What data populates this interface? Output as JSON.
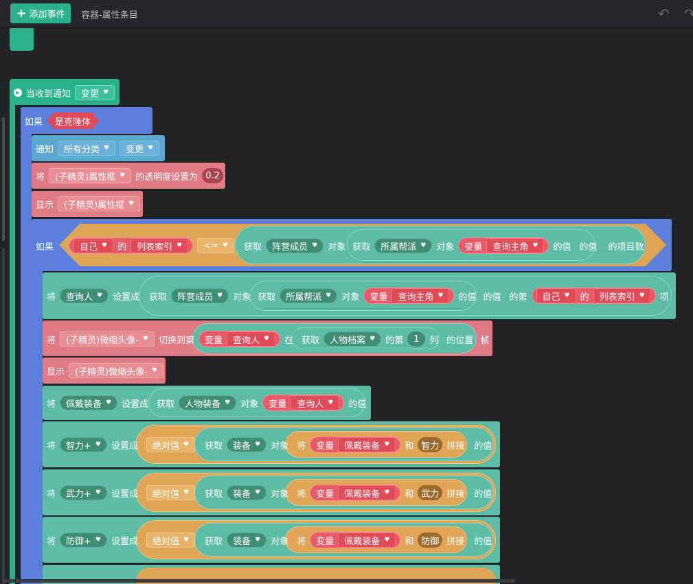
{
  "topbar": {
    "add_label": "添加事件",
    "title": "容器-属性条目",
    "undo_icon": "↶",
    "redo_icon": "↷"
  },
  "hat": {
    "label": "当收到通知",
    "dropdown": "变更"
  },
  "if1": {
    "label": "如果",
    "condition": "是克隆体"
  },
  "notify": {
    "label": "通知",
    "target": "所有分类",
    "event": "变更"
  },
  "set_opacity": {
    "prefix": "将",
    "target": "(子精灵)属性框",
    "text": "的透明度设置为",
    "value": "0.2"
  },
  "show1": {
    "label": "显示",
    "target": "(子精灵)属性框"
  },
  "if2": {
    "label": "如果",
    "self": "自己",
    "of": "的",
    "prop": "列表索引",
    "op": "<=",
    "get": "获取",
    "member": "阵营成员",
    "obj": "对象",
    "get2": "获取",
    "faction": "所属帮派",
    "obj2": "对象",
    "var": "变量",
    "varname": "查询主角",
    "val": "的值",
    "val2": "的值",
    "count": "的项目数"
  },
  "set_query": {
    "prefix": "将",
    "target": "查询人",
    "text": "设置成",
    "get": "获取",
    "member": "阵营成员",
    "obj": "对象",
    "get2": "获取",
    "faction": "所属帮派",
    "obj2": "对象",
    "var": "变量",
    "varname": "查询主角",
    "val": "的值",
    "val2": "的值",
    "nth": "的第",
    "self": "自己",
    "of": "的",
    "prop": "列表索引",
    "item": "项"
  },
  "switch_frame": {
    "prefix": "将",
    "target": "(子精灵)微缩头像-",
    "text": "切换到第",
    "var": "变量",
    "varname": "查询人",
    "in": "在",
    "get": "获取",
    "archive": "人物档案",
    "nth": "的第",
    "col": "1",
    "colword": "列",
    "pos": "的位置",
    "frame": "帧"
  },
  "show2": {
    "label": "显示",
    "target": "(子精灵)微缩头像-"
  },
  "set_equip": {
    "prefix": "将",
    "target": "佩戴装备",
    "text": "设置成",
    "get": "获取",
    "equip": "人物装备",
    "obj": "对象",
    "var": "变量",
    "varname": "查询人",
    "val": "的值"
  },
  "stat_rows": [
    {
      "prefix": "将",
      "target": "智力+",
      "text": "设置成",
      "abs": "绝对值",
      "get": "获取",
      "equip": "装备",
      "obj": "对象",
      "jiang": "将",
      "var": "变量",
      "varname": "佩戴装备",
      "and": "和",
      "stat": "智力",
      "concat": "拼接",
      "val": "的值"
    },
    {
      "prefix": "将",
      "target": "武力+",
      "text": "设置成",
      "abs": "绝对值",
      "get": "获取",
      "equip": "装备",
      "obj": "对象",
      "jiang": "将",
      "var": "变量",
      "varname": "佩戴装备",
      "and": "和",
      "stat": "武力",
      "concat": "拼接",
      "val": "的值"
    },
    {
      "prefix": "将",
      "target": "防御+",
      "text": "设置成",
      "abs": "绝对值",
      "get": "获取",
      "equip": "装备",
      "obj": "对象",
      "jiang": "将",
      "var": "变量",
      "varname": "佩戴装备",
      "and": "和",
      "stat": "防御",
      "concat": "拼接",
      "val": "的值"
    }
  ],
  "colors": {
    "event": "#2bb08c",
    "control": "#5a7fdc",
    "sensing": "#6bb0d6",
    "looks": "#e8838b",
    "data": "#5cbca5",
    "operator": "#dda555",
    "variable": "#e24a58"
  }
}
